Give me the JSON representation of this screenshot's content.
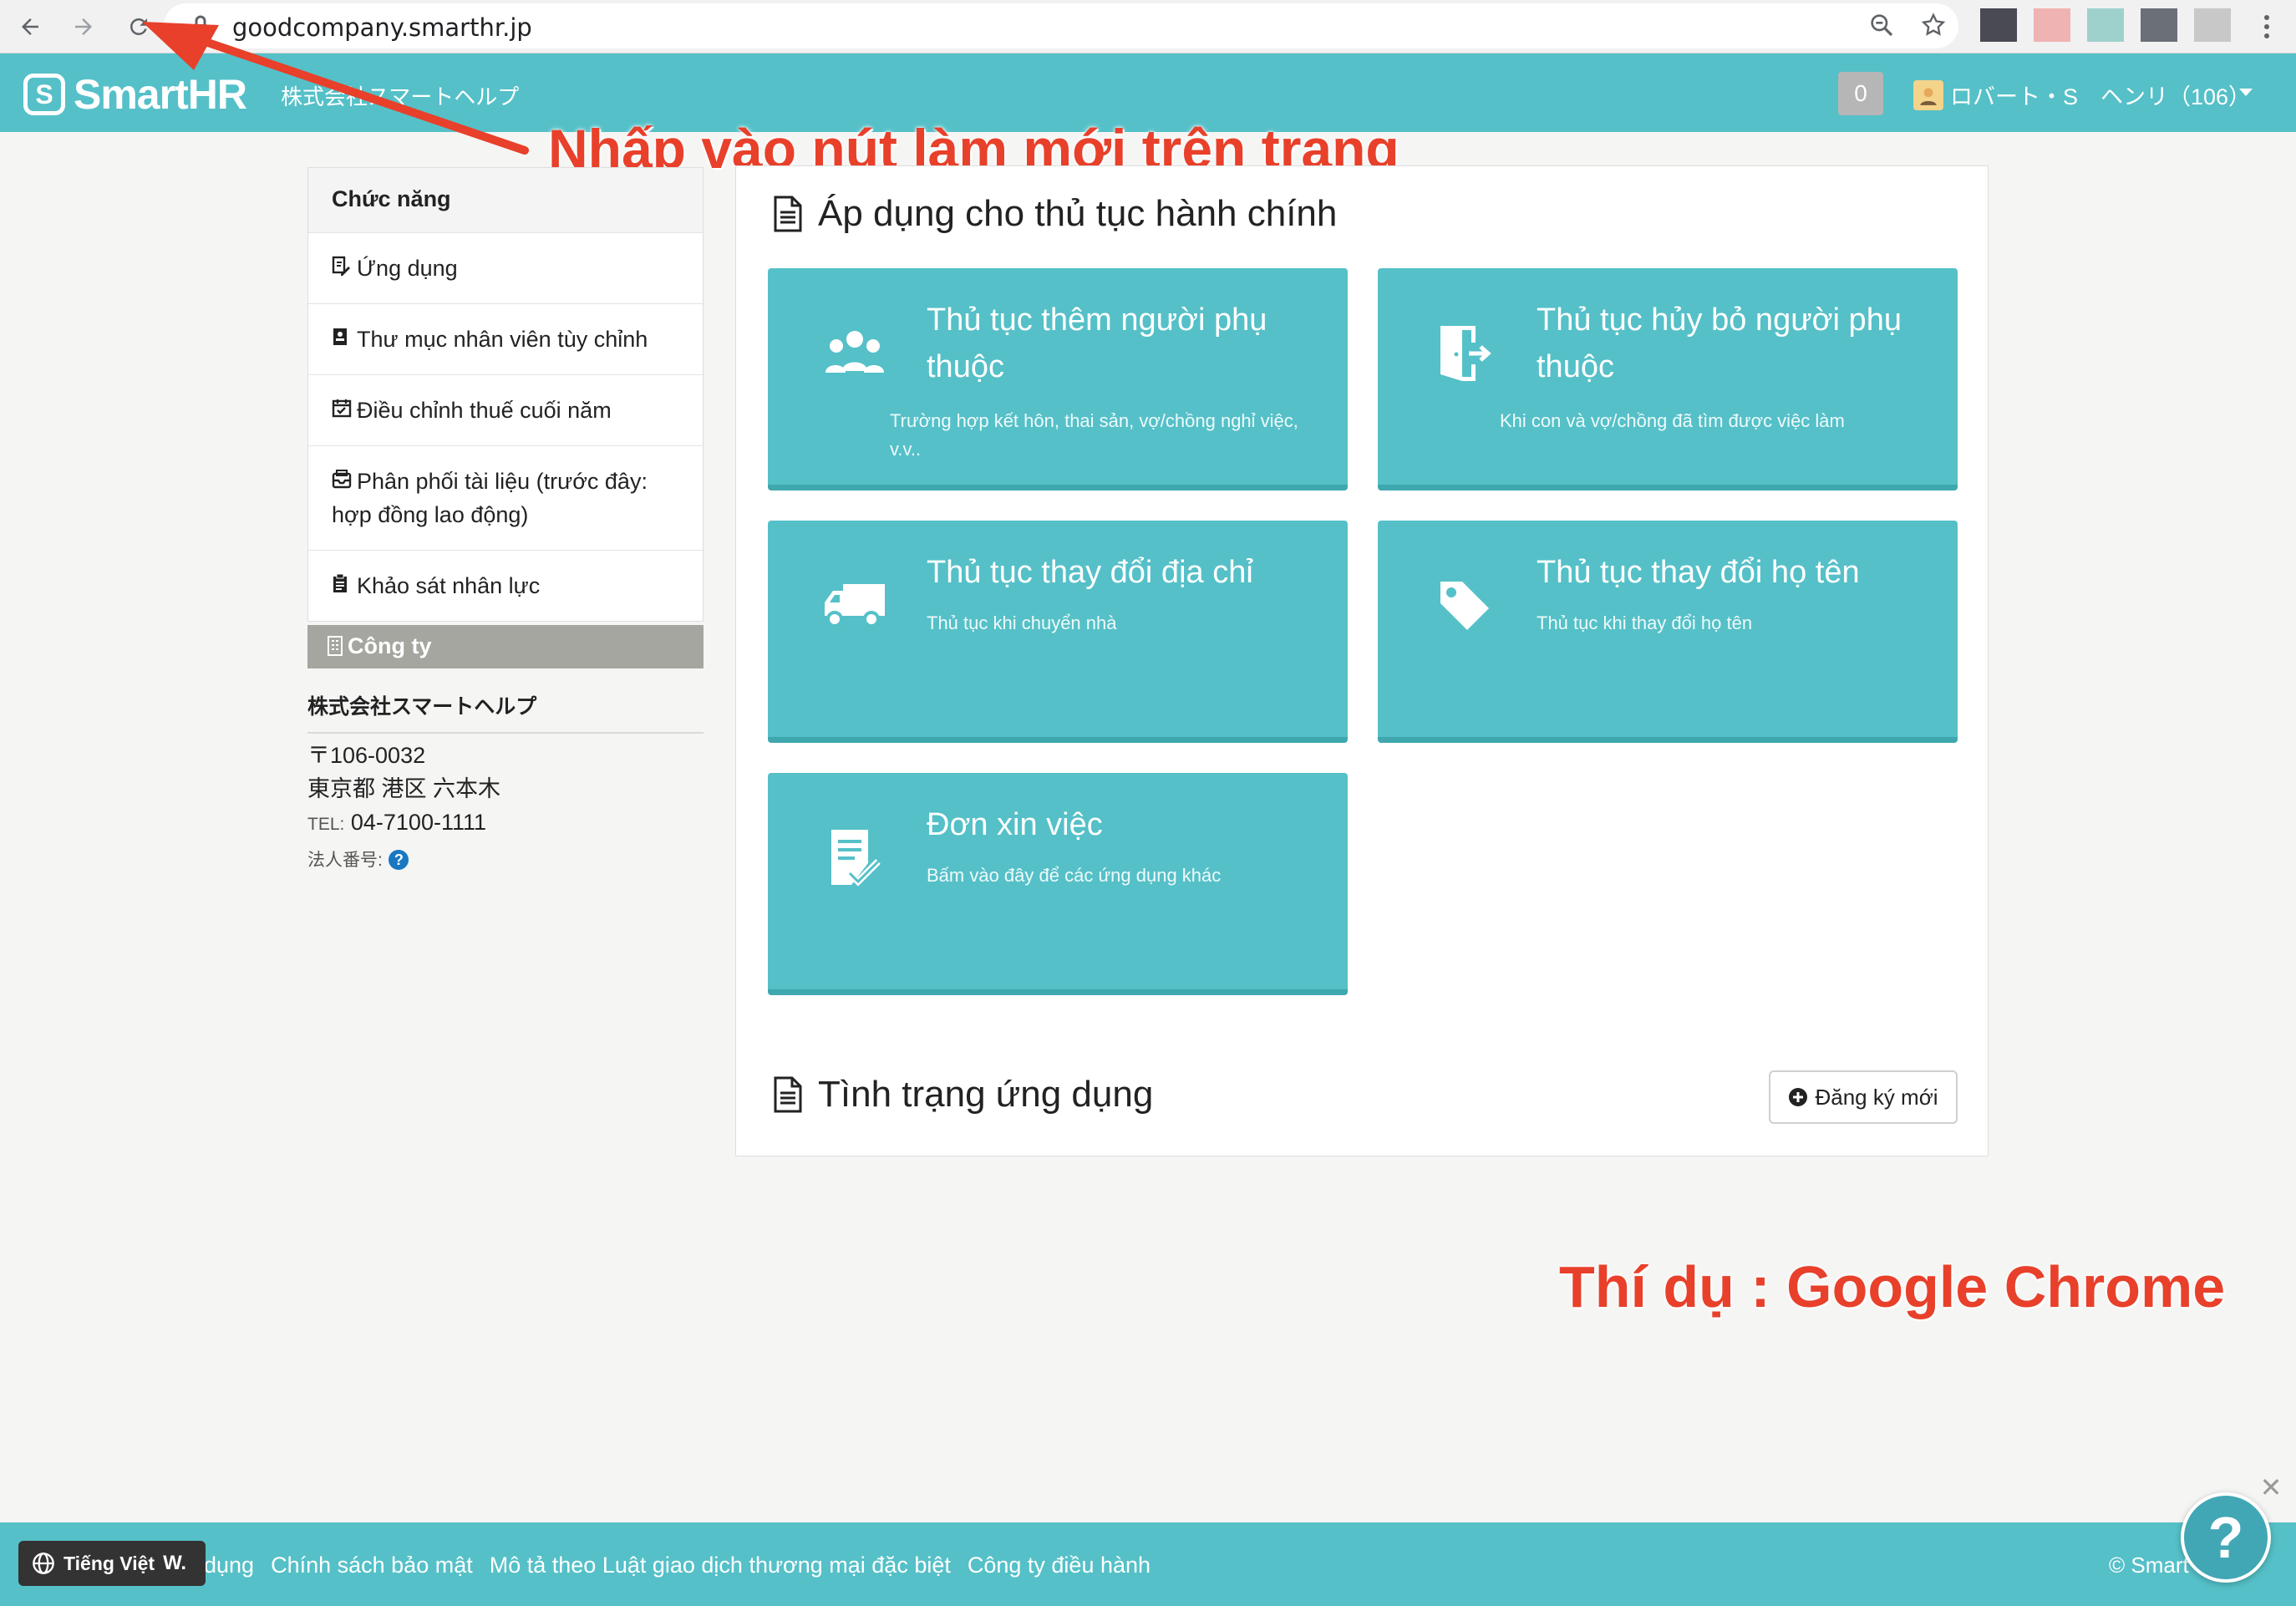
{
  "browser": {
    "url": "goodcompany.smarthr.jp",
    "ext_colors": [
      "#4a4a55",
      "#f0b3b3",
      "#9fd1cc",
      "#6b6f78",
      "#c8c8c8"
    ]
  },
  "header": {
    "logo_text": "SmartHR",
    "company_name": "株式会社スマートヘルプ",
    "notification_count": "0",
    "user_name": "ロバート・S　ヘンリ（106）"
  },
  "sidebar": {
    "heading": "Chức năng",
    "items": [
      {
        "label": "Ứng dụng",
        "icon": "pen-doc-icon"
      },
      {
        "label": "Thư mục nhân viên tùy chỉnh",
        "icon": "directory-icon"
      },
      {
        "label": "Điều chỉnh thuế cuối năm",
        "icon": "calendar-check-icon"
      },
      {
        "label": "Phân phối tài liệu (trước đây: hợp đồng lao động)",
        "icon": "inbox-icon"
      },
      {
        "label": "Khảo sát nhân lực",
        "icon": "clipboard-icon"
      }
    ],
    "company_heading": "Công ty",
    "company_name_jp": "株式会社スマートヘルプ",
    "postal": "〒106-0032",
    "address": "東京都 港区 六本木",
    "tel_label": "TEL:",
    "tel": "04-7100-1111",
    "corp_number_label": "法人番号:"
  },
  "main": {
    "section1_title": "Áp dụng cho thủ tục hành chính",
    "cards": [
      {
        "title": "Thủ tục thêm người phụ thuộc",
        "desc": "Trường hợp kết hôn, thai sản, vợ/chồng nghỉ việc, v.v..",
        "icon": "people-group-icon"
      },
      {
        "title": "Thủ tục hủy bỏ người phụ thuộc",
        "desc": "Khi con và vợ/chồng đã tìm được việc làm",
        "icon": "door-exit-icon"
      },
      {
        "title": "Thủ tục thay đổi địa chỉ",
        "desc": "Thủ tục khi chuyển nhà",
        "icon": "truck-icon"
      },
      {
        "title": "Thủ tục thay đổi họ tên",
        "desc": "Thủ tục khi thay đổi họ tên",
        "icon": "tag-icon"
      },
      {
        "title": "Đơn xin việc",
        "desc": "Bấm vào đây để các ứng dụng khác",
        "icon": "checklist-icon"
      }
    ],
    "section2_title": "Tình trạng ứng dụng",
    "new_button": "Đăng ký mới"
  },
  "annotations": {
    "instruction": "Nhấp vào nút làm mới trên trang",
    "example": "Thí dụ : Google Chrome",
    "color": "#e8402a"
  },
  "footer": {
    "links": [
      "dụng",
      "Chính sách bảo mật",
      "Mô tả theo Luật giao dịch thương mại đặc biệt",
      "Công ty điều hành"
    ],
    "copyright": "© Smart",
    "language": "Tiếng Việt"
  },
  "colors": {
    "brand": "#55c0c8",
    "brand_dark": "#3fa7ae"
  }
}
